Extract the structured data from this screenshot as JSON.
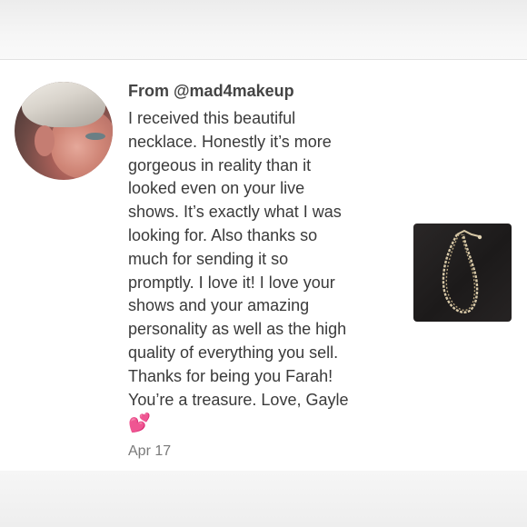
{
  "review": {
    "from": "From @mad4makeup",
    "message": "I received this beautiful\nnecklace. Honestly it’s more\ngorgeous in reality than it\nlooked even on your live\nshows. It’s exactly what I was\nlooking for. Also thanks so\nmuch for sending it so\npromptly. I love it! I love your\nshows and your amazing\npersonality as well as the high\nquality of everything you sell.\nThanks for being you Farah!\nYou’re a treasure. Love, Gayle",
    "emoji": "💕",
    "date": "Apr 17"
  },
  "icons": {
    "avatar": "reviewer-avatar-photo",
    "product": "necklace-product-photo"
  },
  "colors": {
    "card_background": "#ffffff",
    "text_primary": "#3a3a3a",
    "text_secondary": "#7a7a7a",
    "emoji": "#e8489a"
  }
}
